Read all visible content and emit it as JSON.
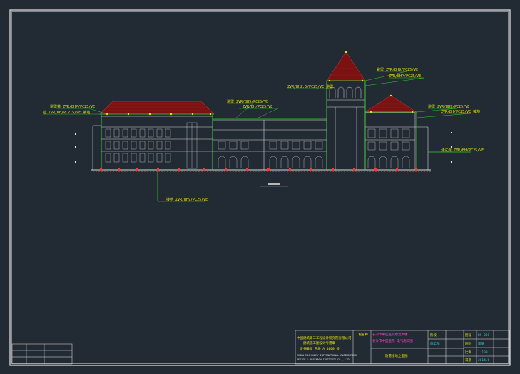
{
  "colors": {
    "background": "#222a33",
    "frame": "#e8e8e8",
    "roof": "#7a1212",
    "facade": "#d8d8d8",
    "annotation_text": "#e6e600",
    "leader_line": "#33cc33",
    "ground_conductor": "#ff3333",
    "titleblock_text_yellow": "#e6e600",
    "titleblock_text_magenta": "#ff44cc",
    "titleblock_text_cyan": "#33cccc"
  },
  "annotations": {
    "left_roof_note_1": "避雷带 ZVR/BHP/PC25/VE",
    "left_roof_note_2": "检 ZVR/BH/PC2.5/VE 接地",
    "mid_roof_note_1": "避雷 ZVR/BH9/PC25/VE",
    "mid_roof_note_2": "ZVR/BH/PC25/VE",
    "tower_note_1": "避雷 ZVR/BH9/PC25/VE",
    "tower_note_2": "ZVR/BHP/PC25/VE",
    "tower_note_3": "ZVR/BH2.5/PC25/VE 避雷",
    "right_roof_note_1": "避雷 ZVR/BH9/PC25/VE",
    "right_roof_note_2": "ZVR/BH/PC25/VE 接地",
    "right_side_note": "测试点 ZVR/BH/PC25/VE",
    "ground_note": "接地 ZVR/BH9/PC25/VE"
  },
  "title_block": {
    "company_cn": "中国建筑第三工程设计研究院有限公司",
    "company_sub_cn": "建筑施工图设计专用章",
    "company_line3_cn": "证书编号 甲级 A 1000 号",
    "company_en_1": "CHINA MACHINERY INTERNATIONAL ENGINEERING",
    "company_en_2": "DESIGN & RESEARCH INSTITUTE CO., LTD.",
    "project_label": "工程名称",
    "project_name_1": "长沙市中医医院康复大楼",
    "project_name_2": "长沙市中医医院 电气施工图",
    "drawing_title": "防雷接地立面图",
    "drawing_no_label": "图号",
    "drawing_no": "DS 031",
    "sheet_label": "比例",
    "sheet_value": "1:100",
    "code_label": "图别",
    "code_value": "电施",
    "date_label": "日期",
    "date_value": "2014.6",
    "stage_label": "阶段",
    "stage_value": "施工图"
  }
}
